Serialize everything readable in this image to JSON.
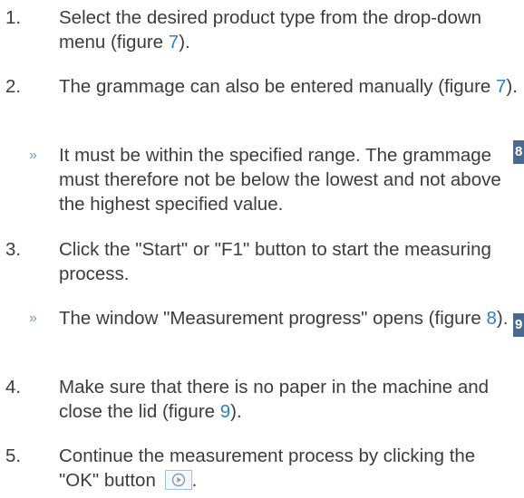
{
  "steps": [
    {
      "number": "1.",
      "before": "Select the desired product type from the drop-down menu (figure ",
      "ref": "7",
      "after": ")."
    },
    {
      "number": "2.",
      "before": "The grammage can also be entered manually (figure ",
      "ref": "7",
      "after": ")."
    },
    {
      "marker": "»",
      "text": "It must be within the specified range. The grammage must therefore not be below the lowest and not above the highest specified value."
    },
    {
      "number": "3.",
      "text": "Click the \"Start\" or \"F1\" button to start the measuring process."
    },
    {
      "marker": "»",
      "before": "The window \"Measurement progress\" opens (figure ",
      "ref": "8",
      "after": ")."
    },
    {
      "number": "4.",
      "before": "Make sure that there is no paper in the machine and close the lid (figure ",
      "ref": "9",
      "after": ")."
    },
    {
      "number": "5.",
      "before": "Continue the measurement process by clicking the \"OK\" button ",
      "after": "."
    }
  ],
  "side_tabs": [
    "8",
    "9"
  ],
  "icons": {
    "ok_button": "play-circle-icon"
  },
  "colors": {
    "text": "#3c3c3c",
    "figure_ref": "#2f7fc1",
    "result_marker": "#6f9bc4",
    "side_tab": "#4a6b8f"
  }
}
